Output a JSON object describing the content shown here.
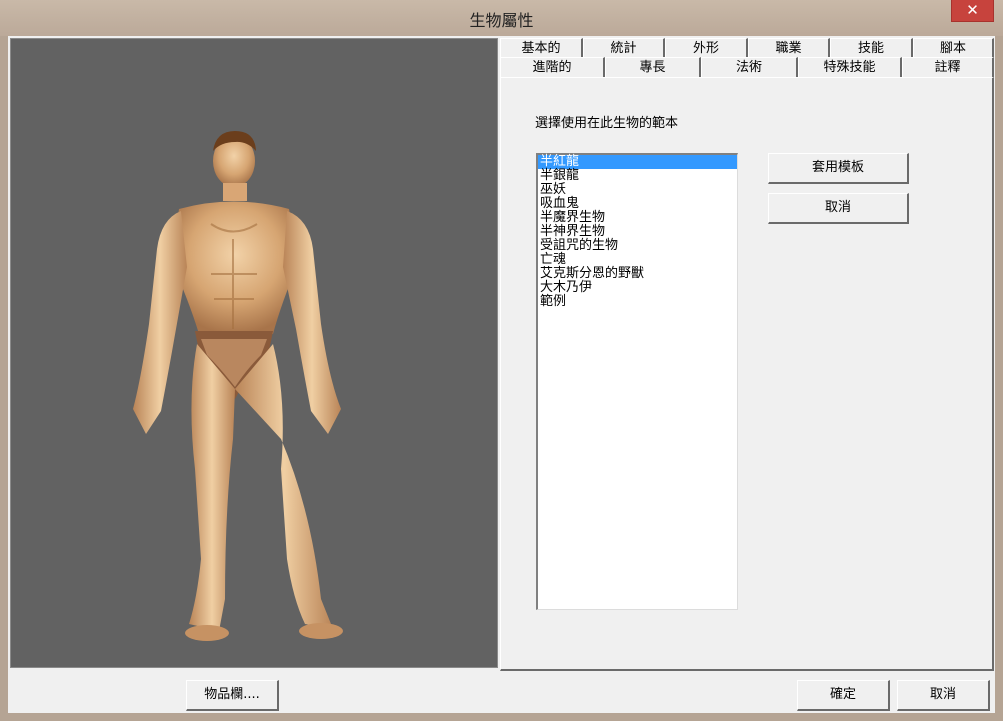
{
  "window": {
    "title": "生物屬性",
    "close_label": "✕"
  },
  "tabs": {
    "back_row": [
      "基本的",
      "統計",
      "外形",
      "職業",
      "技能",
      "腳本"
    ],
    "front_row": [
      "進階的",
      "專長",
      "法術",
      "特殊技能",
      "註釋"
    ]
  },
  "template_page": {
    "prompt": "選擇使用在此生物的範本",
    "templates": [
      "半紅龍",
      "半銀龍",
      "巫妖",
      "吸血鬼",
      "半魔界生物",
      "半神界生物",
      "受詛咒的生物",
      "亡魂",
      "艾克斯分恩的野獸",
      "大木乃伊",
      "範例"
    ],
    "selected_index": 0,
    "apply_label": "套用模板",
    "cancel_label": "取消"
  },
  "footer": {
    "inventory_label": "物品欄....",
    "ok_label": "確定",
    "cancel_label": "取消"
  },
  "colors": {
    "viewport_bg": "#626262",
    "selection": "#3399ff",
    "close_button": "#c7433d"
  }
}
